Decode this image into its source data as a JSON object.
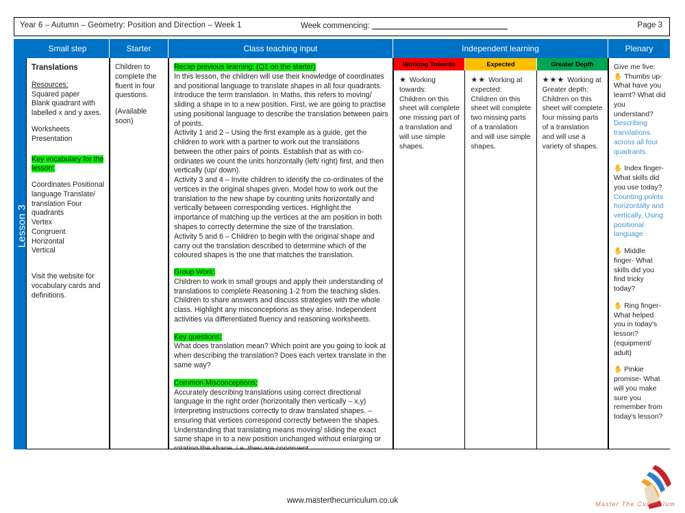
{
  "meta": {
    "left": "Year 6 – Autumn – Geometry: Position and Direction  – Week 1",
    "week_commencing_label": "Week commencing:",
    "page": "Page 3"
  },
  "spine": {
    "lesson_label": "Lesson 3"
  },
  "headers": {
    "small_step": "Small step",
    "starter": "Starter",
    "class_teaching_input": "Class teaching input",
    "independent_learning": "Independent learning",
    "plenary": "Plenary"
  },
  "small_step": {
    "title": "Translations",
    "resources_label": "Resources:",
    "resources": "Squared paper\nBlank quadrant with labelled x and y axes.",
    "materials": "Worksheets\nPresentation",
    "key_vocab_heading": "Key vocabulary for the lesson:",
    "vocabulary": "Coordinates Positional language Translate/ translation Four quadrants\nVertex\nCongruent\nHorizontal\nVertical",
    "website_note": "Visit the website for vocabulary cards and definitions."
  },
  "starter": {
    "text": "Children to complete the fluent in four questions.",
    "availability": "(Available soon)"
  },
  "class_input": {
    "recap_heading": "Recap previous learning: (Q1 on the starter)",
    "recap_body": "In this lesson, the children will use their knowledge of coordinates and positional language to translate shapes in all four quadrants. Introduce the term translation. In Maths, this refers to moving/ sliding a shape in to a new position. First, we are going to practise using positional language to describe the translation between pairs of points.",
    "activity_1_2": "Activity 1 and 2 – Using the first example as a guide, get the children to work with a partner to work out the translations between the other pairs of points.  Establish that as with co-ordinates we count the units horizontally (left/ right) first, and then vertically (up/ down).",
    "activity_3_4": "Activity 3 and 4 – Invite children to identify the co-ordinates of the vertices in the original shapes given. Model how to work out the translation to the new shape by counting units horizontally and vertically between corresponding vertices. Highlight the importance of matching up the vertices at the am position in both shapes to correctly determine the size of the translation.",
    "activity_5_6": "Activity 5 and 6 – Children to begin with the original shape and carry out the translation described to determine which of the coloured shapes is the one that matches the translation.",
    "group_work_heading": "Group Work:",
    "group_work_body": "Children to work in small groups and apply their understanding of translations to complete Reasoning 1-2 from the teaching slides. Children to share answers and discuss strategies with the whole class. Highlight any misconceptions as they arise. Independent activities via differentiated fluency and reasoning worksheets.",
    "key_questions_heading": "Key questions:",
    "key_questions_body": "What does translation mean? Which point are you going to look at when describing the translation? Does each vertex translate in the same way?",
    "misconceptions_heading": "Common Misconceptions:",
    "misconceptions_body": "Accurately describing translations using correct directional language in the right order (horizontally  then vertically – x,y)\nInterpreting instructions correctly to draw translated shapes. – ensuring that vertices correspond correctly  between the shapes.\nUnderstanding that translating means moving/ sliding the exact same shape in to a new position unchanged without enlarging or rotating the shape, i.e. they are congruent."
  },
  "independent": {
    "bands": [
      {
        "label": "Working Towards",
        "color": "#ff0000"
      },
      {
        "label": "Expected",
        "color": "#ffc000"
      },
      {
        "label": "Greater Depth",
        "color": "#00a651"
      }
    ],
    "columns": [
      {
        "stars": "★",
        "star_count": 1,
        "heading": "Working towards:",
        "body": "Children on this sheet will complete one missing part of a translation and will use simple shapes."
      },
      {
        "stars": "★★",
        "star_count": 2,
        "heading": "Working at expected:",
        "body": "Children on this sheet will complete two missing parts of a translation and will use simple shapes."
      },
      {
        "stars": "★★★",
        "star_count": 3,
        "heading": "Working at Greater depth:",
        "body": "Children on this sheet will complete four missing parts of a translation and will use a variety of shapes."
      }
    ]
  },
  "plenary": {
    "title": "Give me five:",
    "hand_icon": "✋",
    "answer_color": "#3a96d3",
    "items": [
      {
        "prompt": "Thumbs up- What have you learnt? What did you understand?",
        "answer": "Describing translations across all four quadrants."
      },
      {
        "prompt": "Index finger- What skills did you use today?",
        "answer": "Counting points horizontally and vertically, Using positional language"
      },
      {
        "prompt": "Middle finger- What skills did you find tricky today?",
        "answer": ""
      },
      {
        "prompt": "Ring finger- What helped you in today's lesson? (equipment/ adult)",
        "answer": ""
      },
      {
        "prompt": "Pinkie promise- What will you make sure you remember from today's lesson?",
        "answer": ""
      }
    ]
  },
  "footer": {
    "url": "www.masterthecurriculum.co.uk",
    "logo_text": "Master  The  Curriculum"
  }
}
